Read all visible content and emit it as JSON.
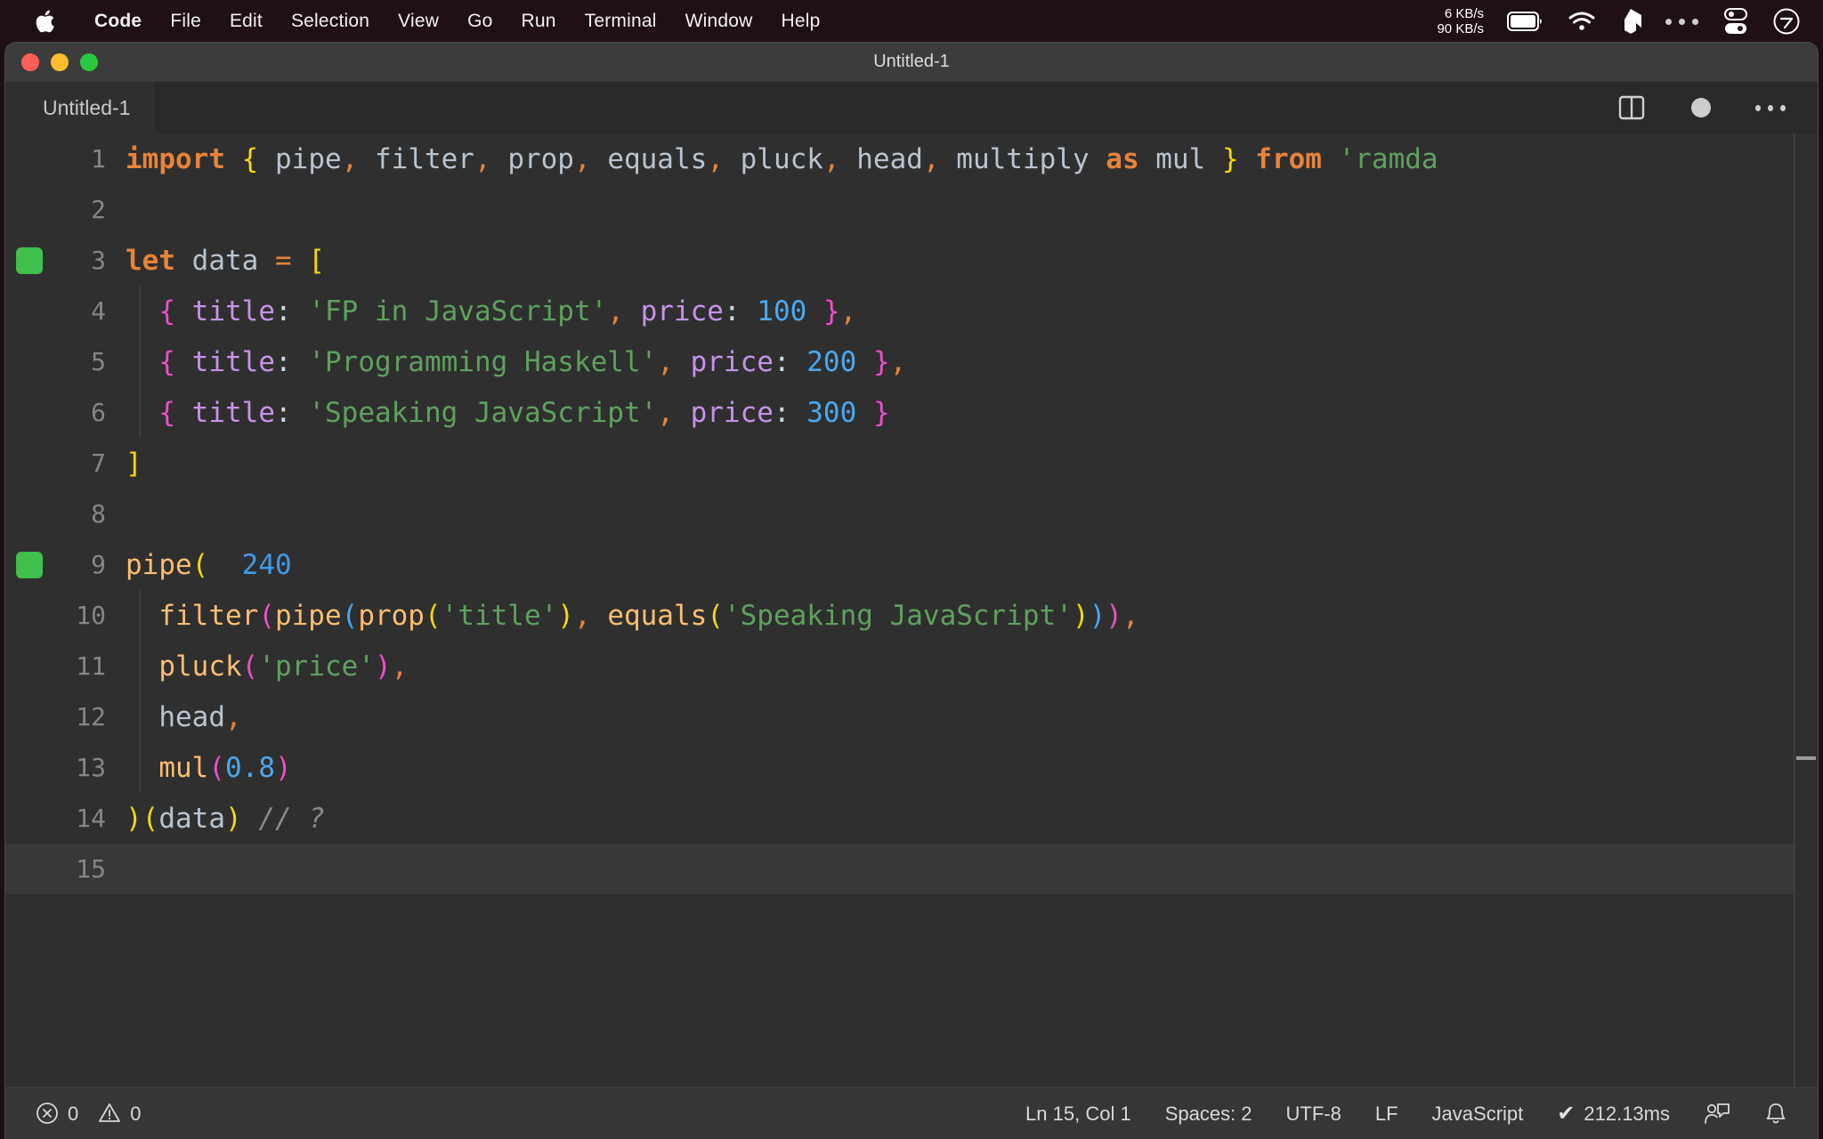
{
  "menubar": {
    "apple_icon": "apple-logo-icon",
    "items": [
      {
        "label": "Code",
        "bold": true
      },
      {
        "label": "File",
        "bold": false
      },
      {
        "label": "Edit",
        "bold": false
      },
      {
        "label": "Selection",
        "bold": false
      },
      {
        "label": "View",
        "bold": false
      },
      {
        "label": "Go",
        "bold": false
      },
      {
        "label": "Run",
        "bold": false
      },
      {
        "label": "Terminal",
        "bold": false
      },
      {
        "label": "Window",
        "bold": false
      },
      {
        "label": "Help",
        "bold": false
      }
    ],
    "network": {
      "up": "6 KB/s",
      "down": "90 KB/s"
    },
    "status_icons": [
      "battery-icon",
      "wifi-icon",
      "dropbox-icon",
      "ellipsis-icon",
      "control-center-icon",
      "siri-icon"
    ]
  },
  "window": {
    "title": "Untitled-1",
    "traffic_lights": [
      "close-button",
      "minimize-button",
      "maximize-button"
    ]
  },
  "tabbar": {
    "tabs": [
      {
        "label": "Untitled-1",
        "active": true
      }
    ],
    "actions": [
      {
        "name": "split-editor-icon",
        "label": "Split Editor"
      },
      {
        "name": "unsaved-dot-icon",
        "label": "Unsaved changes"
      },
      {
        "name": "more-actions-icon",
        "label": "More Actions..."
      }
    ]
  },
  "editor": {
    "language": "JavaScript",
    "lines": [
      {
        "num": "1",
        "marker": false,
        "indent_guide": false,
        "tokens": [
          {
            "t": "import",
            "c": "t-kw"
          },
          {
            "t": " ",
            "c": "t-punct"
          },
          {
            "t": "{",
            "c": "t-br-y"
          },
          {
            "t": " pipe",
            "c": "t-var"
          },
          {
            "t": ",",
            "c": "t-op"
          },
          {
            "t": " filter",
            "c": "t-var"
          },
          {
            "t": ",",
            "c": "t-op"
          },
          {
            "t": " prop",
            "c": "t-var"
          },
          {
            "t": ",",
            "c": "t-op"
          },
          {
            "t": " equals",
            "c": "t-var"
          },
          {
            "t": ",",
            "c": "t-op"
          },
          {
            "t": " pluck",
            "c": "t-var"
          },
          {
            "t": ",",
            "c": "t-op"
          },
          {
            "t": " head",
            "c": "t-var"
          },
          {
            "t": ",",
            "c": "t-op"
          },
          {
            "t": " multiply ",
            "c": "t-var"
          },
          {
            "t": "as",
            "c": "t-kw"
          },
          {
            "t": " mul ",
            "c": "t-var"
          },
          {
            "t": "}",
            "c": "t-br-y"
          },
          {
            "t": " ",
            "c": "t-punct"
          },
          {
            "t": "from",
            "c": "t-kw"
          },
          {
            "t": " ",
            "c": "t-punct"
          },
          {
            "t": "'ramda",
            "c": "t-str"
          }
        ]
      },
      {
        "num": "2",
        "marker": false,
        "indent_guide": false,
        "tokens": []
      },
      {
        "num": "3",
        "marker": true,
        "indent_guide": false,
        "tokens": [
          {
            "t": "let",
            "c": "t-kw"
          },
          {
            "t": " data ",
            "c": "t-var"
          },
          {
            "t": "=",
            "c": "t-op"
          },
          {
            "t": " ",
            "c": "t-punct"
          },
          {
            "t": "[",
            "c": "t-br-y"
          }
        ]
      },
      {
        "num": "4",
        "marker": false,
        "indent_guide": true,
        "tokens": [
          {
            "t": "  ",
            "c": "t-punct"
          },
          {
            "t": "{",
            "c": "t-br-p"
          },
          {
            "t": " ",
            "c": "t-punct"
          },
          {
            "t": "title",
            "c": "t-prop"
          },
          {
            "t": ": ",
            "c": "t-punct"
          },
          {
            "t": "'FP in JavaScript'",
            "c": "t-str"
          },
          {
            "t": ",",
            "c": "t-op"
          },
          {
            "t": " ",
            "c": "t-punct"
          },
          {
            "t": "price",
            "c": "t-prop"
          },
          {
            "t": ": ",
            "c": "t-punct"
          },
          {
            "t": "100",
            "c": "t-num"
          },
          {
            "t": " ",
            "c": "t-punct"
          },
          {
            "t": "}",
            "c": "t-br-p"
          },
          {
            "t": ",",
            "c": "t-op"
          }
        ]
      },
      {
        "num": "5",
        "marker": false,
        "indent_guide": true,
        "tokens": [
          {
            "t": "  ",
            "c": "t-punct"
          },
          {
            "t": "{",
            "c": "t-br-p"
          },
          {
            "t": " ",
            "c": "t-punct"
          },
          {
            "t": "title",
            "c": "t-prop"
          },
          {
            "t": ": ",
            "c": "t-punct"
          },
          {
            "t": "'Programming Haskell'",
            "c": "t-str"
          },
          {
            "t": ",",
            "c": "t-op"
          },
          {
            "t": " ",
            "c": "t-punct"
          },
          {
            "t": "price",
            "c": "t-prop"
          },
          {
            "t": ": ",
            "c": "t-punct"
          },
          {
            "t": "200",
            "c": "t-num"
          },
          {
            "t": " ",
            "c": "t-punct"
          },
          {
            "t": "}",
            "c": "t-br-p"
          },
          {
            "t": ",",
            "c": "t-op"
          }
        ]
      },
      {
        "num": "6",
        "marker": false,
        "indent_guide": true,
        "tokens": [
          {
            "t": "  ",
            "c": "t-punct"
          },
          {
            "t": "{",
            "c": "t-br-p"
          },
          {
            "t": " ",
            "c": "t-punct"
          },
          {
            "t": "title",
            "c": "t-prop"
          },
          {
            "t": ": ",
            "c": "t-punct"
          },
          {
            "t": "'Speaking JavaScript'",
            "c": "t-str"
          },
          {
            "t": ",",
            "c": "t-op"
          },
          {
            "t": " ",
            "c": "t-punct"
          },
          {
            "t": "price",
            "c": "t-prop"
          },
          {
            "t": ": ",
            "c": "t-punct"
          },
          {
            "t": "300",
            "c": "t-num"
          },
          {
            "t": " ",
            "c": "t-punct"
          },
          {
            "t": "}",
            "c": "t-br-p"
          }
        ]
      },
      {
        "num": "7",
        "marker": false,
        "indent_guide": false,
        "tokens": [
          {
            "t": "]",
            "c": "t-br-y"
          }
        ]
      },
      {
        "num": "8",
        "marker": false,
        "indent_guide": false,
        "tokens": []
      },
      {
        "num": "9",
        "marker": true,
        "indent_guide": false,
        "tokens": [
          {
            "t": "pipe",
            "c": "t-fn"
          },
          {
            "t": "(",
            "c": "t-br-y"
          },
          {
            "t": "  ",
            "c": "t-punct"
          },
          {
            "t": "240",
            "c": "t-debug"
          }
        ]
      },
      {
        "num": "10",
        "marker": false,
        "indent_guide": true,
        "tokens": [
          {
            "t": "  ",
            "c": "t-punct"
          },
          {
            "t": "filter",
            "c": "t-fn"
          },
          {
            "t": "(",
            "c": "t-br-p"
          },
          {
            "t": "pipe",
            "c": "t-fn"
          },
          {
            "t": "(",
            "c": "t-br-b"
          },
          {
            "t": "prop",
            "c": "t-fn"
          },
          {
            "t": "(",
            "c": "t-br-y"
          },
          {
            "t": "'title'",
            "c": "t-str"
          },
          {
            "t": ")",
            "c": "t-br-y"
          },
          {
            "t": ",",
            "c": "t-op"
          },
          {
            "t": " ",
            "c": "t-punct"
          },
          {
            "t": "equals",
            "c": "t-fn"
          },
          {
            "t": "(",
            "c": "t-br-y"
          },
          {
            "t": "'Speaking JavaScript'",
            "c": "t-str"
          },
          {
            "t": ")",
            "c": "t-br-y"
          },
          {
            "t": ")",
            "c": "t-br-b"
          },
          {
            "t": ")",
            "c": "t-br-p"
          },
          {
            "t": ",",
            "c": "t-op"
          }
        ]
      },
      {
        "num": "11",
        "marker": false,
        "indent_guide": true,
        "tokens": [
          {
            "t": "  ",
            "c": "t-punct"
          },
          {
            "t": "pluck",
            "c": "t-fn"
          },
          {
            "t": "(",
            "c": "t-br-p"
          },
          {
            "t": "'price'",
            "c": "t-str"
          },
          {
            "t": ")",
            "c": "t-br-p"
          },
          {
            "t": ",",
            "c": "t-op"
          }
        ]
      },
      {
        "num": "12",
        "marker": false,
        "indent_guide": true,
        "tokens": [
          {
            "t": "  ",
            "c": "t-punct"
          },
          {
            "t": "head",
            "c": "t-var"
          },
          {
            "t": ",",
            "c": "t-op"
          }
        ]
      },
      {
        "num": "13",
        "marker": false,
        "indent_guide": true,
        "tokens": [
          {
            "t": "  ",
            "c": "t-punct"
          },
          {
            "t": "mul",
            "c": "t-fn"
          },
          {
            "t": "(",
            "c": "t-br-p"
          },
          {
            "t": "0.8",
            "c": "t-num"
          },
          {
            "t": ")",
            "c": "t-br-p"
          }
        ]
      },
      {
        "num": "14",
        "marker": false,
        "indent_guide": false,
        "tokens": [
          {
            "t": ")",
            "c": "t-br-y"
          },
          {
            "t": "(",
            "c": "t-br-y"
          },
          {
            "t": "data",
            "c": "t-var"
          },
          {
            "t": ")",
            "c": "t-br-y"
          },
          {
            "t": " ",
            "c": "t-punct"
          },
          {
            "t": "// ?",
            "c": "t-comment"
          }
        ]
      },
      {
        "num": "15",
        "marker": false,
        "indent_guide": false,
        "current": true,
        "tokens": []
      }
    ]
  },
  "statusbar": {
    "errors_icon": "error-circle-icon",
    "errors": "0",
    "warnings_icon": "warning-triangle-icon",
    "warnings": "0",
    "cursor_position": "Ln 15, Col 1",
    "indentation": "Spaces: 2",
    "encoding": "UTF-8",
    "eol": "LF",
    "language": "JavaScript",
    "runtime_check": "✔",
    "runtime": "212.13ms",
    "feedback_icon": "feedback-person-icon",
    "bell_icon": "notifications-bell-icon"
  }
}
